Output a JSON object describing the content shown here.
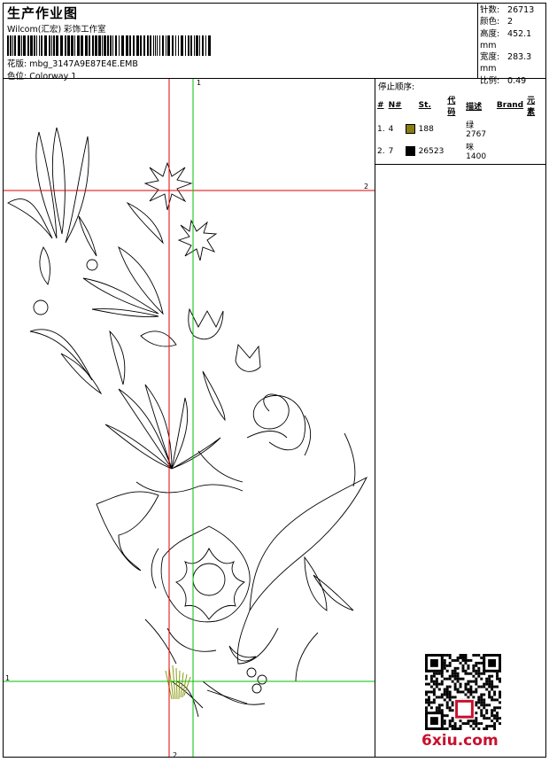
{
  "header": {
    "title": "生产作业图",
    "company": "Wilcom(汇宏) 彩饰工作室",
    "design_label": "花版:",
    "design_name": "mbg_3147A9E87E4E.EMB",
    "color_label": "色位:",
    "color_name": "Colorway 1"
  },
  "stats": [
    {
      "label": "针数:",
      "value": "26713"
    },
    {
      "label": "颜色:",
      "value": "2"
    },
    {
      "label": "高度:",
      "value": "452.1 mm"
    },
    {
      "label": "宽度:",
      "value": "283.3 mm"
    },
    {
      "label": "比例:",
      "value": "0.49"
    }
  ],
  "stop_sequence": {
    "heading": "停止顺序:",
    "columns": [
      "#",
      "N#",
      "St.",
      "代码",
      "描述",
      "Brand",
      "元素"
    ],
    "rows": [
      {
        "num": "1.",
        "n": "4",
        "color": "#8a7d10",
        "st": "188",
        "code": "",
        "desc": "绿2767",
        "brand": "",
        "element": ""
      },
      {
        "num": "2.",
        "n": "7",
        "color": "#000000",
        "st": "26523",
        "code": "",
        "desc": "咪1400",
        "brand": "",
        "element": ""
      }
    ]
  },
  "axes": {
    "top_green": "1",
    "left_green": "1",
    "right_red": "2",
    "bottom_red": "2"
  },
  "watermark": "6xiu.com",
  "colors": {
    "red_guide": "#e00000",
    "green_guide": "#00c000",
    "stitch_green": "#8a9a10"
  }
}
